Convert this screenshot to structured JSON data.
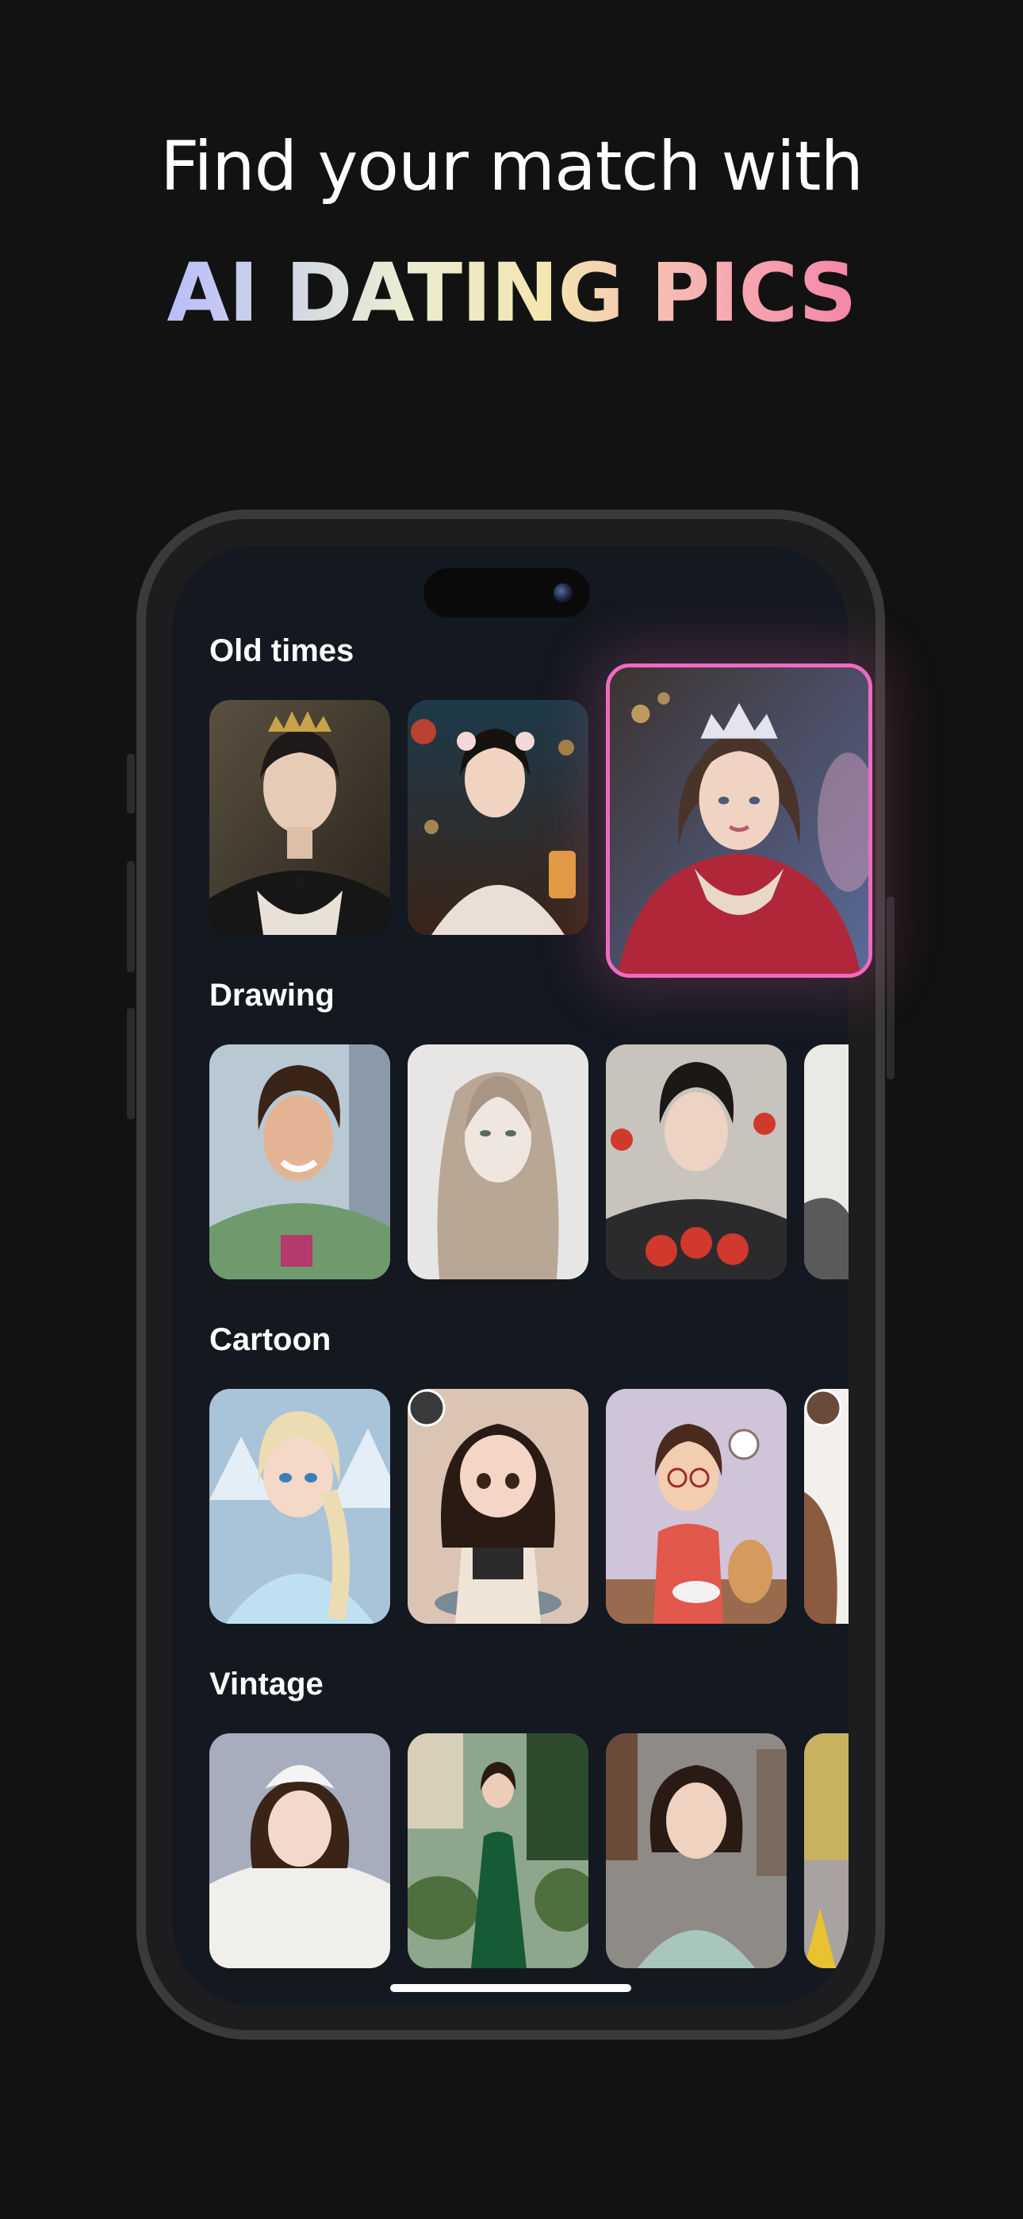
{
  "headline": {
    "line1": "Find your match with",
    "line2": "AI DATING PICS"
  },
  "colors": {
    "background": "#121212",
    "screen": "#141821",
    "highlight_border": "#ef6bc0",
    "gradient": [
      "#b9bdfa",
      "#e8ecd4",
      "#f4e6b0",
      "#f6b7b3",
      "#f585a9"
    ]
  },
  "sections": [
    {
      "title": "Old times"
    },
    {
      "title": "Drawing"
    },
    {
      "title": "Cartoon"
    },
    {
      "title": "Vintage"
    }
  ]
}
